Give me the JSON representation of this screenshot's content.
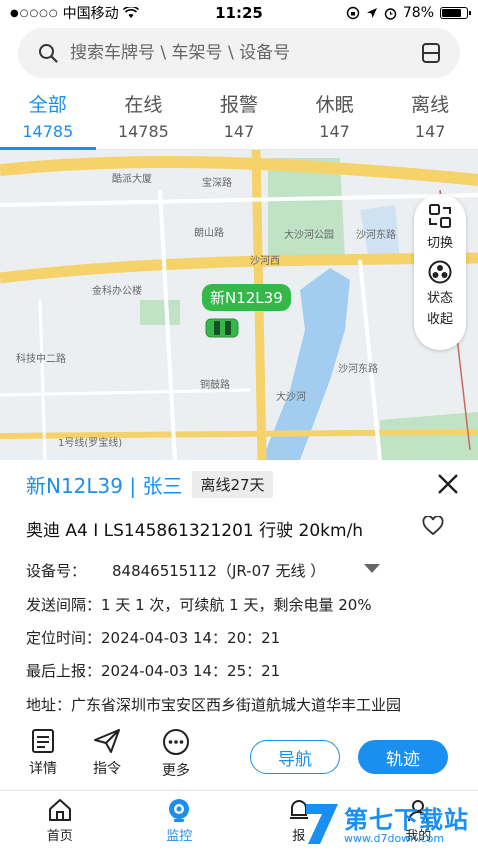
{
  "status_bar": {
    "carrier": "中国移动",
    "time": "11:25",
    "battery": "78%",
    "battery_level": 0.78
  },
  "search": {
    "placeholder": "搜索车牌号 \\ 车架号 \\ 设备号"
  },
  "tabs": [
    {
      "label": "全部",
      "count": "14785",
      "active": true
    },
    {
      "label": "在线",
      "count": "14785",
      "active": false
    },
    {
      "label": "报警",
      "count": "147",
      "active": false
    },
    {
      "label": "休眠",
      "count": "147",
      "active": false
    },
    {
      "label": "离线",
      "count": "147",
      "active": false
    }
  ],
  "map": {
    "labels": {
      "l1": "酷派大厦",
      "l2": "宝深路",
      "l3": "朗山路",
      "l4": "大沙河公园",
      "l5": "沙河西",
      "l6": "金科办公楼",
      "l7": "沙河东路",
      "l8": "科技中二路",
      "l9": "铜鼓路",
      "l10": "沙河东路",
      "l11": "1号线(罗宝线)",
      "l12": "大沙河"
    },
    "controls": {
      "switch_label": "切换",
      "status_label_1": "状态",
      "status_label_2": "收起"
    },
    "marker_plate": "新N12L39",
    "colors": {
      "road": "#f6d26b",
      "water": "#a3cdf0",
      "park": "#bfe3c4",
      "marker": "#34b84a"
    }
  },
  "panel": {
    "title": "新N12L39 | 张三",
    "badge": "离线27天",
    "vehicle_line": "奥迪 A4 I LS145861321201 行驶 20km/h",
    "device_label": "设备号：",
    "device_value": "84846515112（JR-07 无线 ）",
    "interval_label": "发送间隔：",
    "interval_value": "1 天 1 次，可续航 1 天，剩余电量 20%",
    "locate_label": "定位时间：",
    "locate_value": "2024-04-03 14：20：21",
    "report_label": "最后上报：",
    "report_value": "2024-04-03 14：25：21",
    "address_label": "地址：",
    "address_value": "广东省深圳市宝安区西乡街道航城大道华丰工业园",
    "actions": {
      "detail": "详情",
      "command": "指令",
      "more": "更多",
      "navigate": "导航",
      "track": "轨迹"
    }
  },
  "bottom_nav": [
    {
      "label": "首页",
      "icon": "home-icon",
      "active": false
    },
    {
      "label": "监控",
      "icon": "monitor-icon",
      "active": true
    },
    {
      "label": "报",
      "icon": "alarm-icon",
      "active": false
    },
    {
      "label": "我的",
      "icon": "user-icon",
      "active": false
    }
  ],
  "watermark": {
    "text": "第七下载站",
    "url": "www.d7down.com"
  },
  "accent_color": "#1a8ff0"
}
